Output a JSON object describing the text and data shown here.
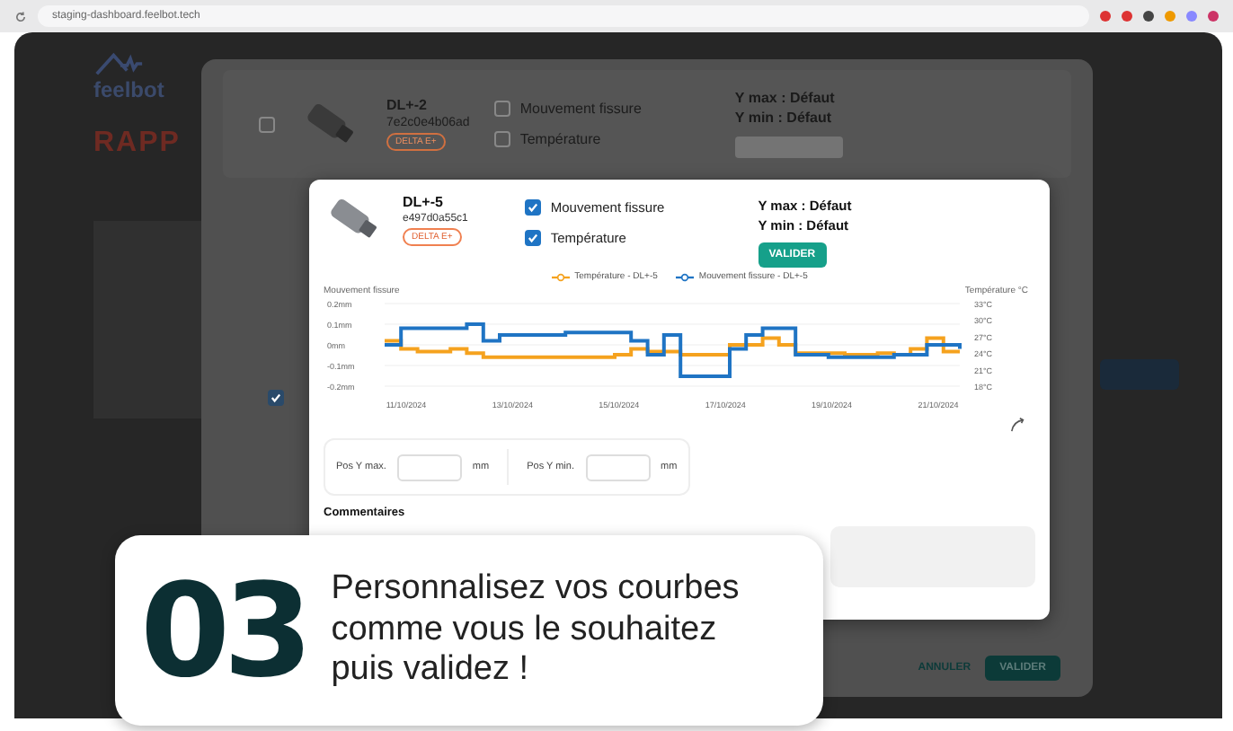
{
  "browser": {
    "url": "staging-dashboard.feelbot.tech"
  },
  "app": {
    "logo": "feelbot",
    "heading": "RAPP"
  },
  "background_dialog": {
    "row": {
      "checked": false,
      "name": "DL+-2",
      "serial": "7e2c0e4b06ad",
      "tag": "DELTA E+",
      "y_max": "Y max : Défaut",
      "y_min": "Y min : Défaut",
      "options": [
        {
          "label": "Mouvement fissure",
          "checked": false
        },
        {
          "label": "Température",
          "checked": false
        }
      ]
    },
    "second_row_checked": true,
    "buttons": [
      {
        "label": "ANNULER",
        "kind": "text"
      },
      {
        "label": "VALIDER",
        "kind": "filled"
      }
    ]
  },
  "dialog": {
    "name": "DL+-5",
    "serial": "e497d0a55c1",
    "tag": "DELTA E+",
    "y_max": "Y max : Défaut",
    "y_min": "Y min : Défaut",
    "validate": "VALIDER",
    "options": [
      {
        "label": "Mouvement fissure",
        "checked": true
      },
      {
        "label": "Température",
        "checked": true
      }
    ],
    "chart": {
      "left_axis_label": "Mouvement fissure",
      "right_axis_label": "Température °C",
      "left_ticks": [
        "0.2mm",
        "0.1mm",
        "0mm",
        "-0.1mm",
        "-0.2mm"
      ],
      "right_ticks": [
        "33°C",
        "30°C",
        "27°C",
        "24°C",
        "21°C",
        "18°C"
      ],
      "x_labels": [
        "11/10/2024",
        "13/10/2024",
        "15/10/2024",
        "17/10/2024",
        "19/10/2024",
        "21/10/2024"
      ],
      "legend": [
        {
          "label": "Température - DL+-5",
          "color": "#f5a21e"
        },
        {
          "label": "Mouvement fissure - DL+-5",
          "color": "#1f74c4"
        }
      ]
    },
    "pos_y_max": {
      "label": "Pos Y max.",
      "unit": "mm"
    },
    "pos_y_min": {
      "label": "Pos Y min.",
      "unit": "mm"
    },
    "comments_label": "Commentaires"
  },
  "callout": {
    "number": "03",
    "text": "Personnalisez vos courbes comme vous le souhaitez puis validez !"
  }
}
